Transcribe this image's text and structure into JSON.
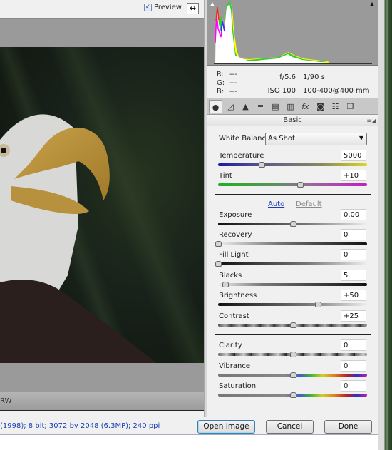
{
  "toolbar": {
    "preview_label": "Preview",
    "preview_checked": true,
    "preview_check_glyph": "✓",
    "fullscreen_icon": "↔"
  },
  "preview": {
    "status_text": "RW"
  },
  "histogram": {
    "shadow_clip_icon": "▲",
    "highlight_clip_icon": "▲"
  },
  "readout": {
    "r_label": "R:",
    "r_value": "---",
    "g_label": "G:",
    "g_value": "---",
    "b_label": "B:",
    "b_value": "---",
    "aperture": "f/5.6",
    "shutter": "1/90 s",
    "iso": "ISO 100",
    "lens": "100-400@400 mm"
  },
  "tabs": [
    {
      "name": "basic",
      "icon": "●",
      "active": true
    },
    {
      "name": "tone-curve",
      "icon": "◿"
    },
    {
      "name": "detail",
      "icon": "▲"
    },
    {
      "name": "hsl",
      "icon": "≡"
    },
    {
      "name": "split-toning",
      "icon": "▤"
    },
    {
      "name": "lens-corrections",
      "icon": "▥"
    },
    {
      "name": "effects",
      "icon": "fx"
    },
    {
      "name": "camera-calibration",
      "icon": "◙"
    },
    {
      "name": "presets",
      "icon": "☷"
    },
    {
      "name": "snapshots",
      "icon": "❐"
    }
  ],
  "panel": {
    "section_title": "Basic",
    "menu_icon": "☰◢",
    "white_balance_label": "White Balance:",
    "white_balance_value": "As Shot",
    "auto_label": "Auto",
    "default_label": "Default"
  },
  "sliders": [
    {
      "key": "temperature",
      "label": "Temperature",
      "value": "5000",
      "position": 0.29,
      "track": "temp"
    },
    {
      "key": "tint",
      "label": "Tint",
      "value": "+10",
      "position": 0.55,
      "track": "tint"
    },
    {
      "key": "exposure",
      "label": "Exposure",
      "value": "0.00",
      "position": 0.5,
      "track": "exposure"
    },
    {
      "key": "recovery",
      "label": "Recovery",
      "value": "0",
      "position": 0.0,
      "track": "recovery"
    },
    {
      "key": "fill-light",
      "label": "Fill Light",
      "value": "0",
      "position": 0.0,
      "track": "fill"
    },
    {
      "key": "blacks",
      "label": "Blacks",
      "value": "5",
      "position": 0.05,
      "track": "blacks"
    },
    {
      "key": "brightness",
      "label": "Brightness",
      "value": "+50",
      "position": 0.67,
      "track": "brightness"
    },
    {
      "key": "contrast",
      "label": "Contrast",
      "value": "+25",
      "position": 0.5,
      "track": "contrast"
    },
    {
      "key": "clarity",
      "label": "Clarity",
      "value": "0",
      "position": 0.5,
      "track": "clarity"
    },
    {
      "key": "vibrance",
      "label": "Vibrance",
      "value": "0",
      "position": 0.5,
      "track": "spectrum"
    },
    {
      "key": "saturation",
      "label": "Saturation",
      "value": "0",
      "position": 0.5,
      "track": "spectrum"
    }
  ],
  "footer": {
    "workflow_info": "(1998); 8 bit; 3072 by 2048 (6.3MP); 240 ppi",
    "open_image_label": "Open Image",
    "cancel_label": "Cancel",
    "done_label": "Done"
  }
}
